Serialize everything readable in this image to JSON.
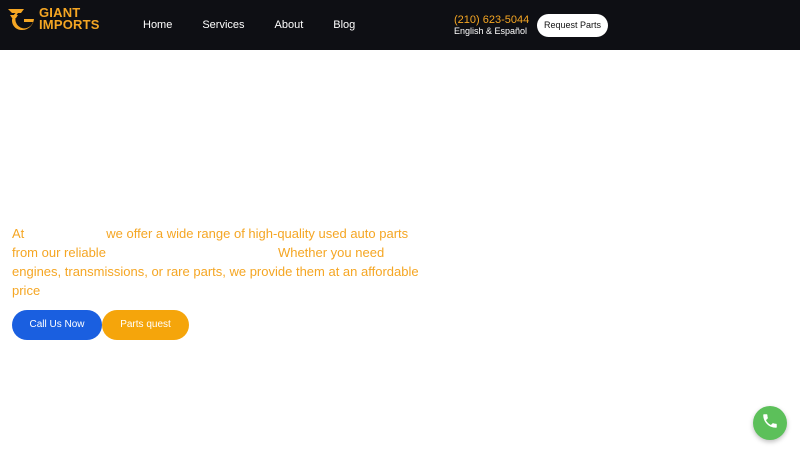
{
  "brand": {
    "line1": "GIANT",
    "line2": "IMPORTS",
    "accent_color": "#f5a623"
  },
  "nav": {
    "items": [
      {
        "label": "Home"
      },
      {
        "label": "Services"
      },
      {
        "label": "About"
      },
      {
        "label": "Blog"
      }
    ]
  },
  "contact": {
    "phone": "(210) 623-5044",
    "language": "English & Español"
  },
  "header": {
    "request_label": "Request Parts",
    "background_color": "#0e0f14"
  },
  "hero": {
    "part1": "At",
    "part2": "we offer a wide range of high-quality used auto parts from our reliable",
    "part3": "Whether you need engines, transmissions, or rare parts, we provide them at an affordable price"
  },
  "buttons": {
    "call_label": "Call Us Now",
    "call_color": "#1a5fe0",
    "quest_label": "Parts quest",
    "quest_color": "#f5a50b"
  },
  "floating": {
    "icon": "phone-icon",
    "color": "#5cc05a"
  }
}
